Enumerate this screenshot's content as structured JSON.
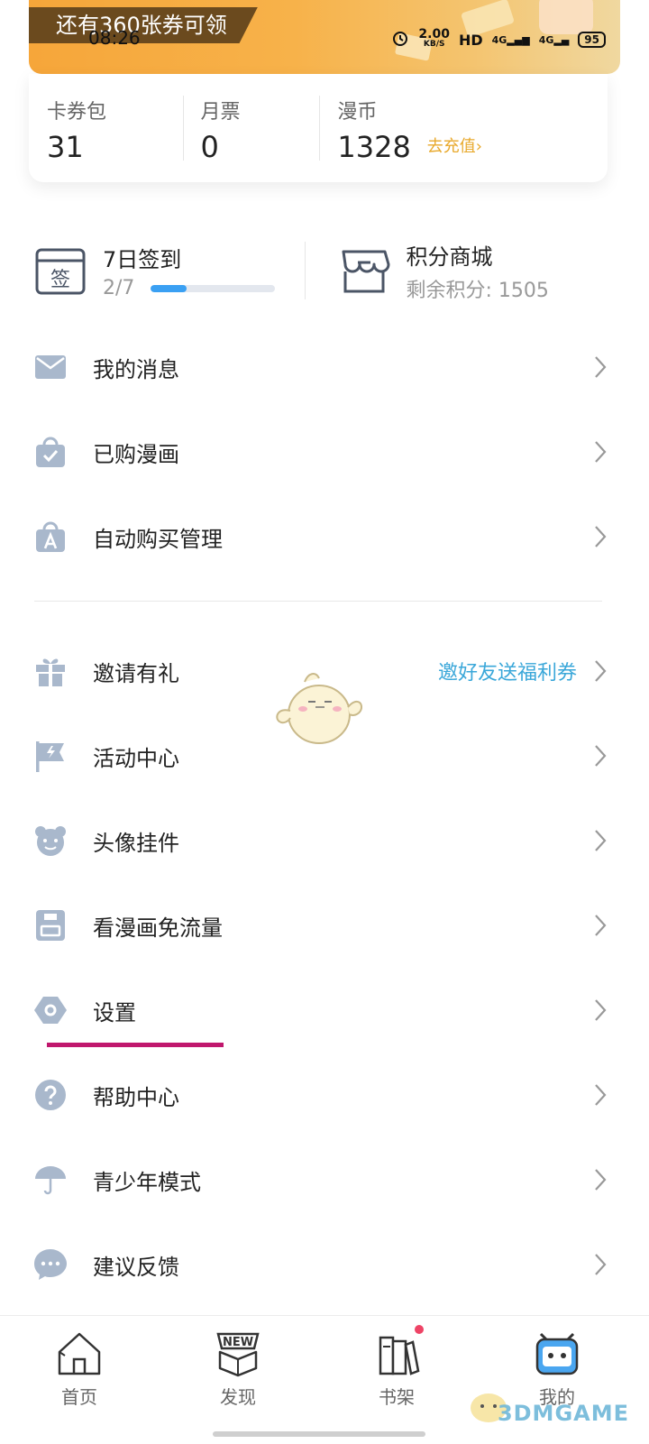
{
  "banner": {
    "tag": "还有360张券可领"
  },
  "status_bar": {
    "time": "08:26",
    "network_speed": "2.00",
    "speed_unit": "KB/S",
    "hd": "HD",
    "signal1": "4G",
    "signal2": "4G",
    "battery": "95"
  },
  "wallet": [
    {
      "label": "卡券包",
      "value": "31"
    },
    {
      "label": "月票",
      "value": "0"
    },
    {
      "label": "漫币",
      "value": "1328",
      "action": "去充值"
    }
  ],
  "checkin": {
    "title": "7日签到",
    "progress_text": "2/7",
    "progress": 0.2857,
    "icon": "calendar-sign-icon",
    "icon_char": "签"
  },
  "points_mall": {
    "title": "积分商城",
    "subtitle": "剩余积分: 1505",
    "icon": "store-icon"
  },
  "menu_group1": [
    {
      "label": "我的消息",
      "icon": "mail-icon"
    },
    {
      "label": "已购漫画",
      "icon": "purchased-bag-icon"
    },
    {
      "label": "自动购买管理",
      "icon": "auto-buy-icon"
    }
  ],
  "menu_group2": [
    {
      "label": "邀请有礼",
      "icon": "gift-icon",
      "extra": "邀好友送福利券"
    },
    {
      "label": "活动中心",
      "icon": "flag-icon"
    },
    {
      "label": "头像挂件",
      "icon": "bear-icon"
    },
    {
      "label": "看漫画免流量",
      "icon": "sim-card-icon"
    },
    {
      "label": "设置",
      "icon": "settings-icon"
    },
    {
      "label": "帮助中心",
      "icon": "help-icon"
    },
    {
      "label": "青少年模式",
      "icon": "umbrella-icon"
    },
    {
      "label": "建议反馈",
      "icon": "chat-icon"
    }
  ],
  "tabs": [
    {
      "label": "首页",
      "icon": "home-icon"
    },
    {
      "label": "发现",
      "icon": "new-box-icon"
    },
    {
      "label": "书架",
      "icon": "bookshelf-icon"
    },
    {
      "label": "我的",
      "icon": "robot-icon"
    }
  ],
  "watermark": "3DMGAME",
  "colors": {
    "accent_blue": "#3aa0f3",
    "icon_gray": "#a9b8cc",
    "link_blue": "#3aa7d9",
    "recharge": "#e8a92c",
    "underline": "#c0176d",
    "banner": "#f6a63a"
  }
}
